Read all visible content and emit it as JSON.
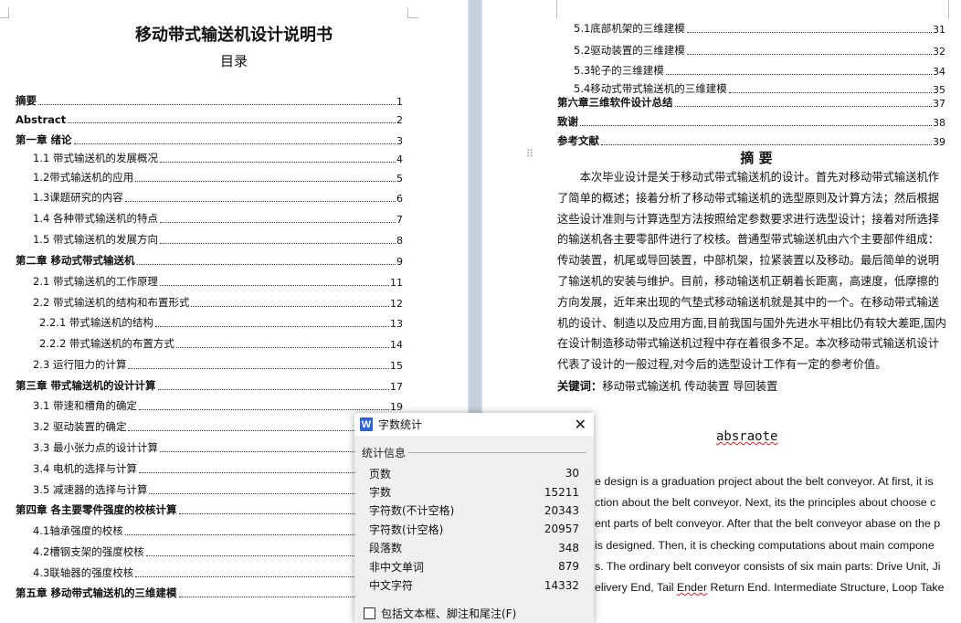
{
  "left_page": {
    "doc_title": "移动带式输送机设计说明书",
    "toc_heading": "目录",
    "toc": [
      {
        "t": "摘要",
        "n": "1",
        "level": 0
      },
      {
        "t": "Abstract",
        "n": "2",
        "level": 0
      },
      {
        "t": "第一章  绪论",
        "n": "3",
        "level": 0
      },
      {
        "t": "1.1 带式输送机的发展概况",
        "n": "4",
        "level": 1
      },
      {
        "t": "1.2带式输送机的应用",
        "n": "5",
        "level": 1
      },
      {
        "t": "1.3课题研究的内容",
        "n": "6",
        "level": 1
      },
      {
        "t": "1.4 各种带式输送机的特点",
        "n": "7",
        "level": 1
      },
      {
        "t": "1.5 带式输送机的发展方向",
        "n": "8",
        "level": 1
      },
      {
        "t": "第二章  移动式带式输送机",
        "n": "9",
        "level": 0
      },
      {
        "t": "2.1 带式输送机的工作原理",
        "n": "11",
        "level": 1
      },
      {
        "t": "2.2 带式输送机的结构和布置形式",
        "n": "12",
        "level": 1
      },
      {
        "t": "2.2.1 带式输送机的结构",
        "n": "13",
        "level": 2
      },
      {
        "t": "2.2.2 带式输送机的布置方式",
        "n": "14",
        "level": 2
      },
      {
        "t": "2.3 运行阻力的计算",
        "n": "15",
        "level": 1
      },
      {
        "t": "第三章  带式输送机的设计计算",
        "n": "17",
        "level": 0
      },
      {
        "t": "3.1 带速和槽角的确定",
        "n": "19",
        "level": 1
      },
      {
        "t": "3.2 驱动装置的确定",
        "n": "",
        "level": 1
      },
      {
        "t": "3.3 最小张力点的设计计算",
        "n": "",
        "level": 1
      },
      {
        "t": "3.4 电机的选择与计算",
        "n": "",
        "level": 1
      },
      {
        "t": "3.5 减速器的选择与计算",
        "n": "",
        "level": 1
      },
      {
        "t": "第四章  各主要零件强度的校核计算",
        "n": "",
        "level": 0
      },
      {
        "t": "4.1轴承强度的校核",
        "n": "",
        "level": 1
      },
      {
        "t": "4.2槽钢支架的强度校核",
        "n": "",
        "level": 1
      },
      {
        "t": "4.3联轴器的强度校核",
        "n": "",
        "level": 1
      },
      {
        "t": "第五章  移动带式输送机的三维建模",
        "n": "",
        "level": 0
      }
    ]
  },
  "right_page": {
    "toc": [
      {
        "t": "5.1底部机架的三维建模",
        "n": "31",
        "level": 1
      },
      {
        "t": "5.2驱动装置的三维建模",
        "n": "32",
        "level": 1
      },
      {
        "t": "5.3轮子的三维建模",
        "n": "34",
        "level": 1
      },
      {
        "t": "5.4移动式带式输送机的三维建模",
        "n": "35",
        "level": 1
      },
      {
        "t": "第六章三维软件设计总结",
        "n": "37",
        "level": 0
      },
      {
        "t": "致谢",
        "n": "38",
        "level": 0
      },
      {
        "t": "参考文献",
        "n": "39",
        "level": 0
      }
    ],
    "abstract_heading": "摘  要",
    "abstract_lines": [
      "　　本次毕业设计是关于移动式带式输送机的设计。首先对移动带式输送机作",
      "了简单的概述；接着分析了移动带式输送机的选型原则及计算方法；然后根据",
      "这些设计准则与计算选型方法按照给定参数要求进行选型设计；接着对所选择",
      "的输送机各主要零部件进行了校核。普通型带式输送机由六个主要部件组成：",
      "传动装置，机尾或导回装置，中部机架，拉紧装置以及移动。最后简单的说明",
      "了输送机的安装与维护。目前，移动输送机正朝着长距离，高速度，低摩擦的",
      "方向发展，近年来出现的气垫式移动输送机就是其中的一个。在移动带式输送",
      "机的设计、制造以及应用方面,目前我国与国外先进水平相比仍有较大差距,国内",
      "在设计制造移动带式输送机过程中存在着很多不足。本次移动带式输送机设计",
      "代表了设计的一般过程,对今后的选型设计工作有一定的参考价值。"
    ],
    "keywords_label": "关键词：",
    "keywords": "移动带式输送机  传动装置  导回装置",
    "english_heading": "absraote",
    "english_lines": [
      "e design is a graduation project about the belt conveyor. At first, it is",
      "ction about the belt conveyor. Next, its the principles about choose c",
      "ent parts of belt conveyor. After that the belt conveyor abase on the p",
      " is designed. Then, it is checking computations about main compone",
      "s. The ordinary belt conveyor consists of six main parts: Drive Unit, Ji",
      "elivery End, Tail "
    ],
    "english_last_wavy": "Ender",
    "english_last_rest": " Return End. Intermediate Structure, Loop Take"
  },
  "dialog": {
    "title": "字数统计",
    "group": "统计信息",
    "stats": [
      {
        "label": "页数",
        "value": "30"
      },
      {
        "label": "字数",
        "value": "15211"
      },
      {
        "label": "字符数(不计空格)",
        "value": "20343"
      },
      {
        "label": "字符数(计空格)",
        "value": "20957"
      },
      {
        "label": "段落数",
        "value": "348"
      },
      {
        "label": "非中文单词",
        "value": "879"
      },
      {
        "label": "中文字符",
        "value": "14332"
      }
    ],
    "checkbox_label": "包括文本框、脚注和尾注(F)",
    "checkbox_checked": false,
    "accent": "#2b63d9"
  }
}
